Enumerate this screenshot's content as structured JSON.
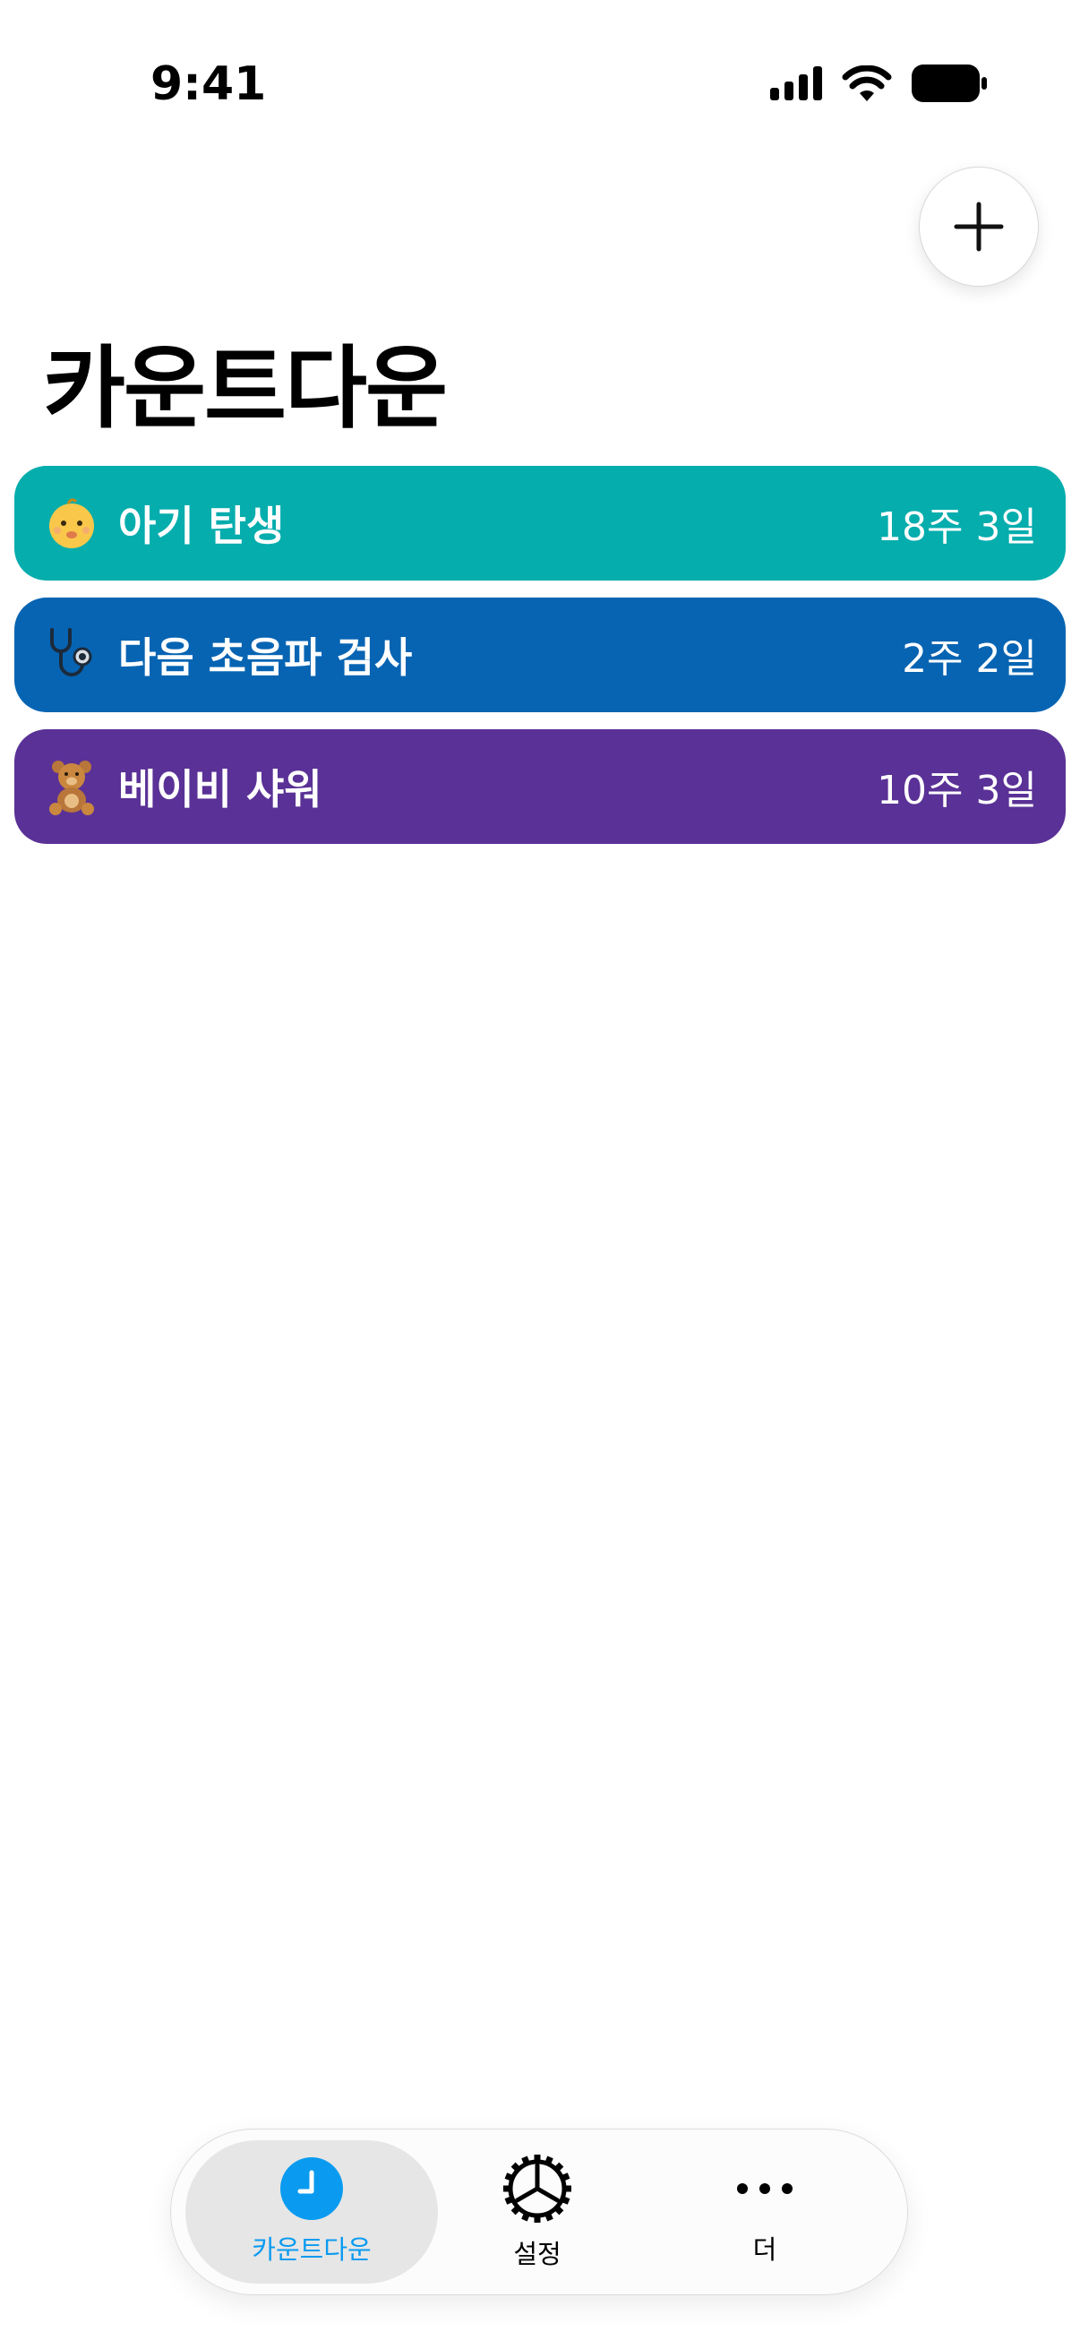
{
  "status_bar": {
    "time": "9:41"
  },
  "header": {
    "title": "카운트다운",
    "add_icon": "plus-icon"
  },
  "countdowns": [
    {
      "emoji": "baby",
      "title": "아기 탄생",
      "value": "18주 3일",
      "color": "#05ADAD"
    },
    {
      "emoji": "stethoscope",
      "title": "다음 초음파 검사",
      "value": "2주 2일",
      "color": "#0764B3"
    },
    {
      "emoji": "teddy-bear",
      "title": "베이비 샤워",
      "value": "10주 3일",
      "color": "#5A3196"
    }
  ],
  "tab_bar": {
    "tabs": [
      {
        "label": "카운트다운",
        "icon": "clock-icon",
        "selected": true,
        "color": "#0A9BF0"
      },
      {
        "label": "설정",
        "icon": "gear-icon",
        "selected": false,
        "color": "#000000"
      },
      {
        "label": "더",
        "icon": "more-icon",
        "selected": false,
        "color": "#000000"
      }
    ]
  }
}
